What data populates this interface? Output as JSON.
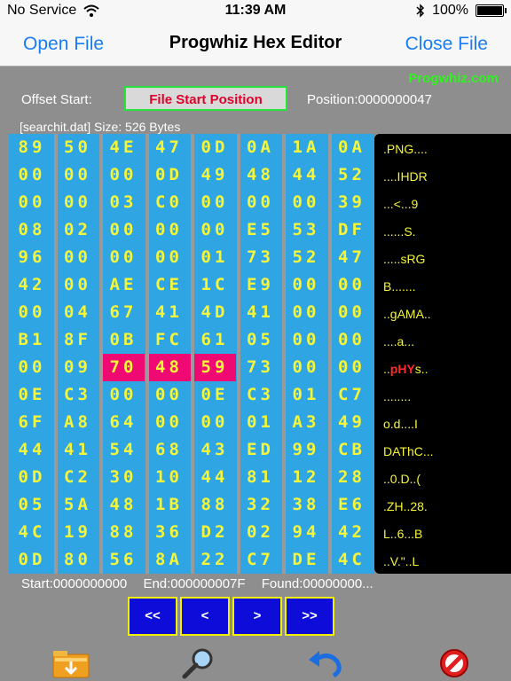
{
  "status": {
    "carrier": "No Service",
    "time": "11:39 AM",
    "battery": "100%"
  },
  "nav": {
    "left": "Open File",
    "title": "Progwhiz Hex Editor",
    "right": "Close File"
  },
  "brand": "Progwhiz.com",
  "offset": {
    "label": "Offset Start:",
    "value": "File Start Position",
    "position": "Position:0000000047"
  },
  "file_info": "[searchit.dat] Size: 526 Bytes",
  "hex_rows": [
    [
      "89",
      "50",
      "4E",
      "47",
      "0D",
      "0A",
      "1A",
      "0A"
    ],
    [
      "00",
      "00",
      "00",
      "0D",
      "49",
      "48",
      "44",
      "52"
    ],
    [
      "00",
      "00",
      "03",
      "C0",
      "00",
      "00",
      "00",
      "39"
    ],
    [
      "08",
      "02",
      "00",
      "00",
      "00",
      "E5",
      "53",
      "DF"
    ],
    [
      "96",
      "00",
      "00",
      "00",
      "01",
      "73",
      "52",
      "47"
    ],
    [
      "42",
      "00",
      "AE",
      "CE",
      "1C",
      "E9",
      "00",
      "00"
    ],
    [
      "00",
      "04",
      "67",
      "41",
      "4D",
      "41",
      "00",
      "00"
    ],
    [
      "B1",
      "8F",
      "0B",
      "FC",
      "61",
      "05",
      "00",
      "00"
    ],
    [
      "00",
      "09",
      "70",
      "48",
      "59",
      "73",
      "00",
      "00"
    ],
    [
      "0E",
      "C3",
      "00",
      "00",
      "0E",
      "C3",
      "01",
      "C7"
    ],
    [
      "6F",
      "A8",
      "64",
      "00",
      "00",
      "01",
      "A3",
      "49"
    ],
    [
      "44",
      "41",
      "54",
      "68",
      "43",
      "ED",
      "99",
      "CB"
    ],
    [
      "0D",
      "C2",
      "30",
      "10",
      "44",
      "81",
      "12",
      "28"
    ],
    [
      "05",
      "5A",
      "48",
      "1B",
      "88",
      "32",
      "38",
      "E6"
    ],
    [
      "4C",
      "19",
      "88",
      "36",
      "D2",
      "02",
      "94",
      "42"
    ],
    [
      "0D",
      "80",
      "56",
      "8A",
      "22",
      "C7",
      "DE",
      "4C"
    ]
  ],
  "selected": [
    [
      8,
      2
    ],
    [
      8,
      3
    ],
    [
      8,
      4
    ]
  ],
  "ascii_rows": [
    ".PNG....",
    "....IHDR",
    "...<...9",
    "......S.",
    ".....sRG",
    "B.......",
    "..gAMA..",
    "....a...",
    "..pHYs..",
    "........",
    "o.d....I",
    "DAThC...",
    "..0.D..(",
    ".ZH..28.",
    "L..6...B",
    "..V.\"..L"
  ],
  "ascii_highlight": {
    "row": 8,
    "start": 2,
    "end": 5
  },
  "footer": {
    "start": "Start:0000000000",
    "end": "End:000000007F",
    "found": "Found:00000000..."
  },
  "nav_buttons": [
    "<<",
    "<",
    ">",
    ">>"
  ],
  "colors": {
    "accent": "#1a7cf5",
    "grid": "#2fa6e3",
    "hex_text": "#f5f53a",
    "selection": "#ee0a72",
    "brand": "#2ef31f"
  },
  "toolbar_icons": [
    "folder-download-icon",
    "magnifier-icon",
    "undo-icon",
    "no-entry-icon"
  ]
}
